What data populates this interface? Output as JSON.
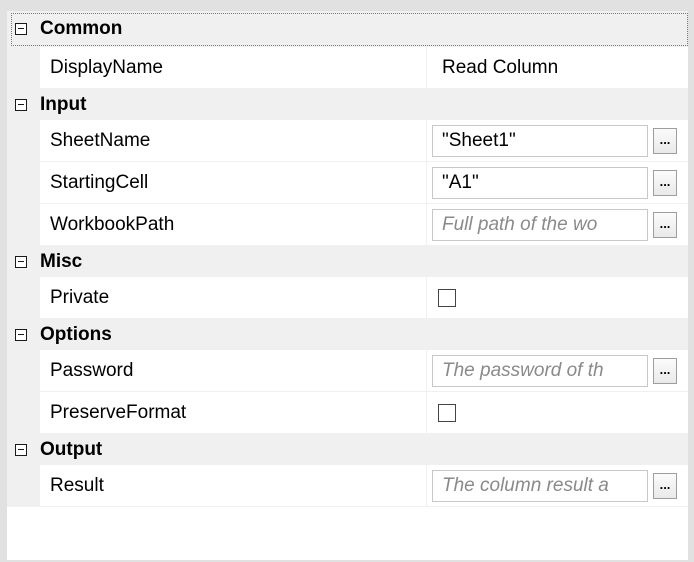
{
  "categories": [
    {
      "label": "Common",
      "properties": [
        {
          "name": "DisplayName",
          "kind": "text",
          "value": "Read Column"
        }
      ]
    },
    {
      "label": "Input",
      "properties": [
        {
          "name": "SheetName",
          "kind": "input",
          "value": "\"Sheet1\""
        },
        {
          "name": "StartingCell",
          "kind": "input",
          "value": "\"A1\""
        },
        {
          "name": "WorkbookPath",
          "kind": "input",
          "placeholder": "Full path of the wo"
        }
      ]
    },
    {
      "label": "Misc",
      "properties": [
        {
          "name": "Private",
          "kind": "checkbox",
          "checked": false
        }
      ]
    },
    {
      "label": "Options",
      "properties": [
        {
          "name": "Password",
          "kind": "input",
          "placeholder": "The password of th"
        },
        {
          "name": "PreserveFormat",
          "kind": "checkbox",
          "checked": false
        }
      ]
    },
    {
      "label": "Output",
      "properties": [
        {
          "name": "Result",
          "kind": "input",
          "placeholder": "The column result a"
        }
      ]
    }
  ],
  "ellipsis_label": "...",
  "icons": {
    "collapse": "minus-box-icon",
    "browse": "ellipsis-icon"
  }
}
